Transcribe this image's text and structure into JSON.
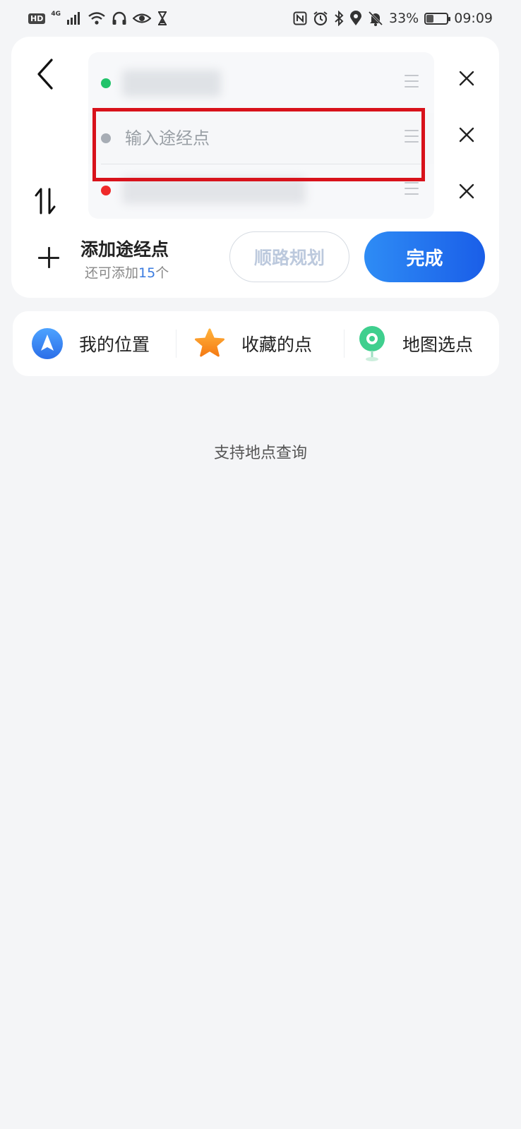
{
  "status_bar": {
    "left_badge": "HD",
    "network": "4G",
    "battery_percent": "33%",
    "battery_level": 0.33,
    "time": "09:09",
    "left_icons": [
      "signal-icon",
      "wifi-icon",
      "headphones-icon",
      "eye-icon",
      "hourglass-icon"
    ],
    "right_icons": [
      "nfc-icon",
      "alarm-icon",
      "bluetooth-icon",
      "location-icon",
      "mute-icon",
      "battery-icon"
    ]
  },
  "route": {
    "back_icon": "chevron-left-icon",
    "swap_icon": "swap-vertical-icon",
    "start_dot_color": "#22c36a",
    "via_dot_color": "#a7adb5",
    "end_dot_color": "#ef2a2a",
    "via_placeholder": "输入途经点",
    "highlight_color": "#d8121b",
    "add_title": "添加途经点",
    "add_sub_prefix": "还可添加",
    "add_sub_count": "15",
    "add_sub_suffix": "个",
    "plan_button": "顺路规划",
    "done_button": "完成"
  },
  "quick_picks": [
    {
      "label": "我的位置",
      "icon": "navigation-arrow-icon",
      "color": "#3b8cf0"
    },
    {
      "label": "收藏的点",
      "icon": "star-icon",
      "color": "#f7941d"
    },
    {
      "label": "地图选点",
      "icon": "map-pin-icon",
      "color": "#3fcf8e"
    }
  ],
  "hint": "支持地点查询"
}
